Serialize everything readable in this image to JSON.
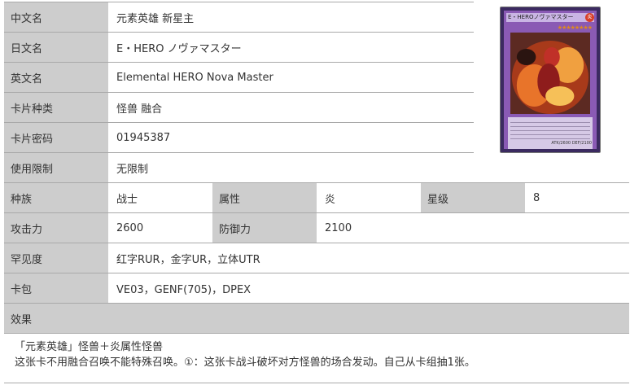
{
  "rows": {
    "cn_name": {
      "label": "中文名",
      "value": "元素英雄 新星主"
    },
    "jp_name": {
      "label": "日文名",
      "value": "E・HERO ノヴァマスター"
    },
    "en_name": {
      "label": "英文名",
      "value": "Elemental HERO Nova Master"
    },
    "card_type": {
      "label": "卡片种类",
      "value": "怪兽 融合"
    },
    "password": {
      "label": "卡片密码",
      "value": "01945387"
    },
    "limit": {
      "label": "使用限制",
      "value": "无限制"
    },
    "race": {
      "label": "种族",
      "value": "战士"
    },
    "attribute": {
      "label": "属性",
      "value": "炎"
    },
    "level": {
      "label": "星级",
      "value": "8"
    },
    "atk": {
      "label": "攻击力",
      "value": "2600"
    },
    "def": {
      "label": "防御力",
      "value": "2100"
    },
    "rarity": {
      "label": "罕见度",
      "value": "红字RUR，金字UR，立体UTR"
    },
    "pack": {
      "label": "卡包",
      "value": "VE03，GENF(705)，DPEX"
    },
    "effect": {
      "label": "效果"
    }
  },
  "effect_lines": [
    "「元素英雄」怪兽＋炎属性怪兽",
    "这张卡不用融合召唤不能特殊召唤。①：这张卡战斗破坏对方怪兽的场合发动。自己从卡组抽1张。"
  ],
  "card_image": {
    "name": "E・HEROノヴァマスター",
    "attribute_glyph": "炎",
    "stars": "★★★★★★★★",
    "stats": "ATK/2600 DEF/2100"
  },
  "colors": {
    "label_bg": "#cdcdcd",
    "border": "#a9a9a9",
    "text": "#333333"
  }
}
